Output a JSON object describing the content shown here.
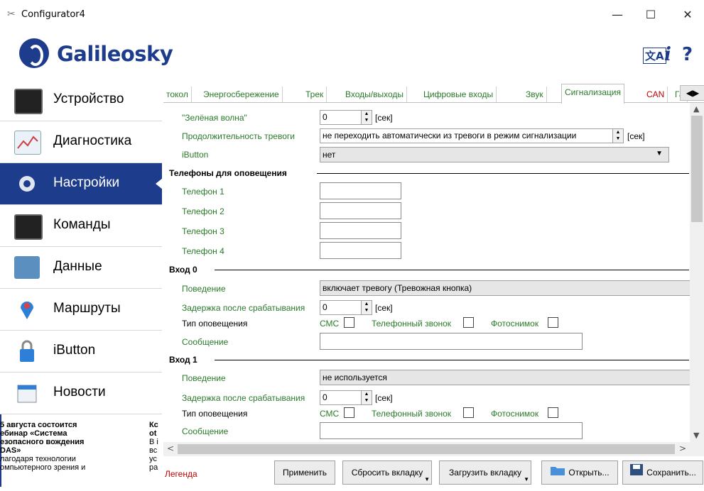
{
  "window": {
    "title": "Configurator4",
    "minimize": "—",
    "maximize": "☐",
    "close": "✕"
  },
  "header": {
    "logo_text": "Galileosky",
    "info_icon": "i",
    "help_icon": "?",
    "translate_icon": "文A"
  },
  "nav": {
    "items": [
      {
        "label": "Устройство",
        "icon": "device-icon"
      },
      {
        "label": "Диагностика",
        "icon": "diagnostics-icon"
      },
      {
        "label": "Настройки",
        "icon": "gear-icon",
        "active": true
      },
      {
        "label": "Команды",
        "icon": "terminal-icon"
      },
      {
        "label": "Данные",
        "icon": "data-icon"
      },
      {
        "label": "Маршруты",
        "icon": "map-pin-icon"
      },
      {
        "label": "iButton",
        "icon": "lock-icon"
      },
      {
        "label": "Новости",
        "icon": "calendar-icon"
      }
    ]
  },
  "news": {
    "col1": {
      "line1": "5 августа состоится",
      "line2": "ебинар «Система",
      "line3": "езопасного вождения",
      "line4": "DAS»",
      "line5": "лагодаря технологии",
      "line6": "омпьютерного зрения и"
    },
    "col2": {
      "line1": "Кс",
      "line2": "ot",
      "line3": "В i",
      "line4": "вс",
      "line5": "ус",
      "line6": "ра"
    }
  },
  "tabs": [
    "токол",
    "Энергосбережение",
    "Трек",
    "Входы/выходы",
    "Цифровые входы",
    "Звук",
    "Сигнализация",
    "CAN",
    "Га"
  ],
  "tab_scroll": "◀▶",
  "form": {
    "green_wave": {
      "label": "\"Зелёная волна\"",
      "value": "0",
      "unit": "[сек]"
    },
    "alarm_duration": {
      "label": "Продолжительность тревоги",
      "value": "не переходить автоматически из тревоги в режим сигнализации",
      "unit": "[сек]"
    },
    "ibutton": {
      "label": "iButton",
      "value": "нет"
    },
    "phones_section": "Телефоны для оповещения",
    "phones": [
      "Телефон 1",
      "Телефон 2",
      "Телефон 3",
      "Телефон 4"
    ],
    "input0": {
      "section": "Вход 0",
      "behavior_label": "Поведение",
      "behavior_value": "включает тревогу (Тревожная кнопка)",
      "delay_label": "Задержка после срабатывания",
      "delay_value": "0",
      "delay_unit": "[сек]",
      "notify_label": "Тип оповещения",
      "sms": "СМС",
      "call": "Телефонный звонок",
      "photo": "Фотоснимок",
      "message_label": "Сообщение"
    },
    "input1": {
      "section": "Вход 1",
      "behavior_label": "Поведение",
      "behavior_value": "не используется",
      "delay_label": "Задержка после срабатывания",
      "delay_value": "0",
      "delay_unit": "[сек]",
      "notify_label": "Тип оповещения",
      "sms": "СМС",
      "call": "Телефонный звонок",
      "photo": "Фотоснимок",
      "message_label": "Сообщение"
    }
  },
  "bottom": {
    "legend": "Легенда",
    "apply": "Применить",
    "reset_tab": "Сбросить вкладку",
    "load_tab": "Загрузить вкладку",
    "open": "Открыть...",
    "save": "Сохранить..."
  },
  "colors": {
    "brand": "#1e3c8c",
    "label_green": "#2a7a2a",
    "legend_red": "#c00000"
  }
}
